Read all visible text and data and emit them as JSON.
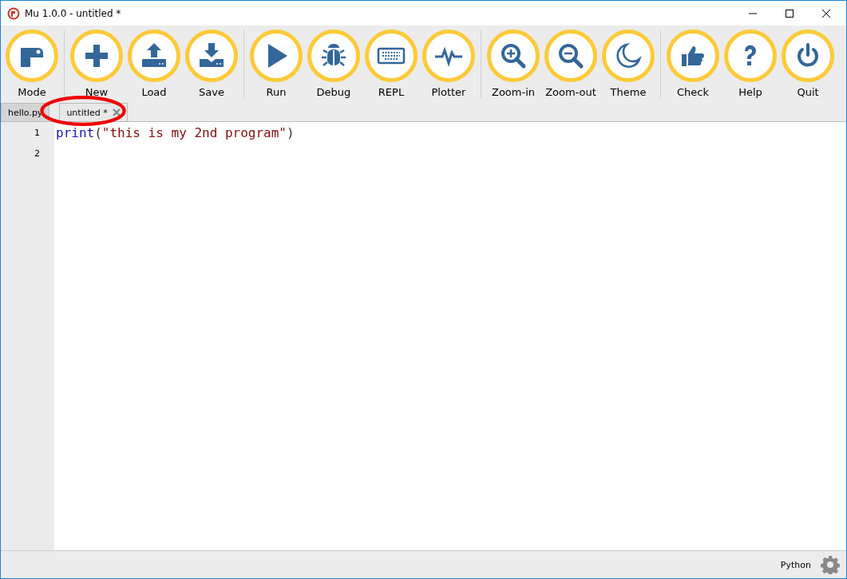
{
  "window": {
    "title": "Mu 1.0.0 - untitled *"
  },
  "toolbar": {
    "groups": [
      [
        {
          "label": "Mode",
          "kind": "mode"
        }
      ],
      [
        {
          "label": "New",
          "kind": "new"
        },
        {
          "label": "Load",
          "kind": "load"
        },
        {
          "label": "Save",
          "kind": "save"
        }
      ],
      [
        {
          "label": "Run",
          "kind": "run"
        },
        {
          "label": "Debug",
          "kind": "debug"
        },
        {
          "label": "REPL",
          "kind": "repl"
        },
        {
          "label": "Plotter",
          "kind": "plotter"
        }
      ],
      [
        {
          "label": "Zoom-in",
          "kind": "zoomin"
        },
        {
          "label": "Zoom-out",
          "kind": "zoomout"
        },
        {
          "label": "Theme",
          "kind": "theme"
        }
      ],
      [
        {
          "label": "Check",
          "kind": "check"
        },
        {
          "label": "Help",
          "kind": "help"
        },
        {
          "label": "Quit",
          "kind": "quit"
        }
      ]
    ]
  },
  "tabs": [
    {
      "label": "hello.py",
      "selected": false,
      "closable": false,
      "circled": false
    },
    {
      "label": "untitled *",
      "selected": true,
      "closable": true,
      "circled": true
    }
  ],
  "editor": {
    "lines": [
      {
        "number": "1",
        "tokens": [
          {
            "kind": "keyword",
            "text": "print"
          },
          {
            "kind": "plain",
            "text": "("
          },
          {
            "kind": "string",
            "text": "\"this is my 2nd program\""
          },
          {
            "kind": "plain",
            "text": ")"
          }
        ]
      },
      {
        "number": "2"
      }
    ]
  },
  "status_bar": {
    "mode": "Python"
  }
}
